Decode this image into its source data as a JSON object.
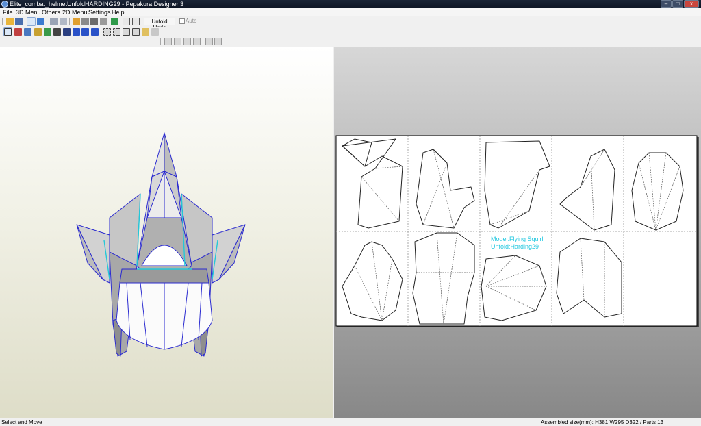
{
  "window": {
    "title": "Elite_combat_helmetUnfoldHARDING29 - Pepakura Designer 3",
    "minimize_glyph": "–",
    "maximize_glyph": "□",
    "close_glyph": "x"
  },
  "menu": {
    "items": [
      "File",
      "3D Menu",
      "Others",
      "2D Menu",
      "Settings",
      "Help"
    ]
  },
  "toolbar": {
    "unfold_undo_label": "Unfold Undo",
    "auto_label": "Auto"
  },
  "pattern": {
    "watermark_line1": "Model:Flying Squirl",
    "watermark_line2": "Unfold:Harding29"
  },
  "status": {
    "mode": "Select and Move",
    "assembled": "Assembled size(mm): H381 W295 D322 / Parts 13"
  },
  "colors": {
    "edge": "#2a2ad0",
    "cyan_edge": "#24c8d8",
    "watermark": "#22c8e0",
    "paper": "#ffffff"
  }
}
